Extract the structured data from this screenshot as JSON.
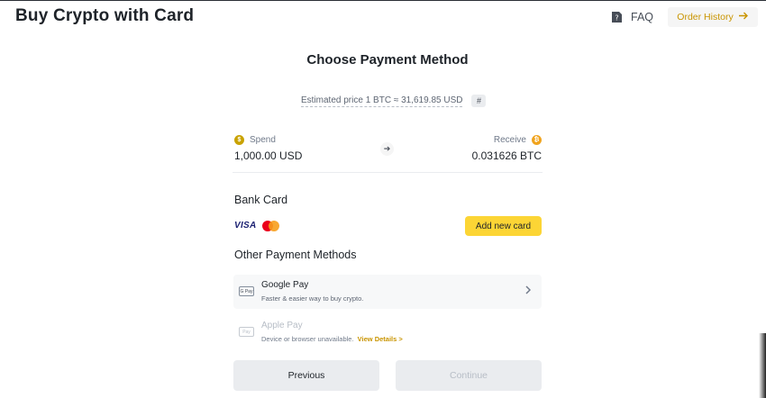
{
  "header": {
    "title": "Buy Crypto with Card",
    "faq_label": "FAQ",
    "order_history_label": "Order History"
  },
  "main": {
    "section_title": "Choose Payment Method",
    "estimated_price": "Estimated price 1 BTC ≈ 31,619.85 USD",
    "refresh_symbol": "#",
    "spend": {
      "label": "Spend",
      "value": "1,000.00 USD",
      "coin_icon": "usd-coin-icon"
    },
    "receive": {
      "label": "Receive",
      "value": "0.031626 BTC",
      "coin_icon": "btc-coin-icon"
    },
    "swap_arrow": "➔",
    "bank_card": {
      "title": "Bank Card",
      "visa_label": "VISA",
      "add_button_label": "Add new card"
    },
    "other_methods": {
      "title": "Other Payment Methods",
      "google_pay": {
        "logo_text": "G Pay",
        "name": "Google Pay",
        "subtitle": "Faster & easier way to buy crypto."
      },
      "apple_pay": {
        "logo_text": "Pay",
        "name": "Apple Pay",
        "subtitle": "Device or browser unavailable.",
        "details_link": "View Details >"
      }
    },
    "buttons": {
      "previous": "Previous",
      "continue": "Continue"
    }
  },
  "colors": {
    "accent_yellow": "#fcd535",
    "link_gold": "#c99400",
    "text_primary": "#1e2329",
    "button_gray": "#eaecef"
  }
}
